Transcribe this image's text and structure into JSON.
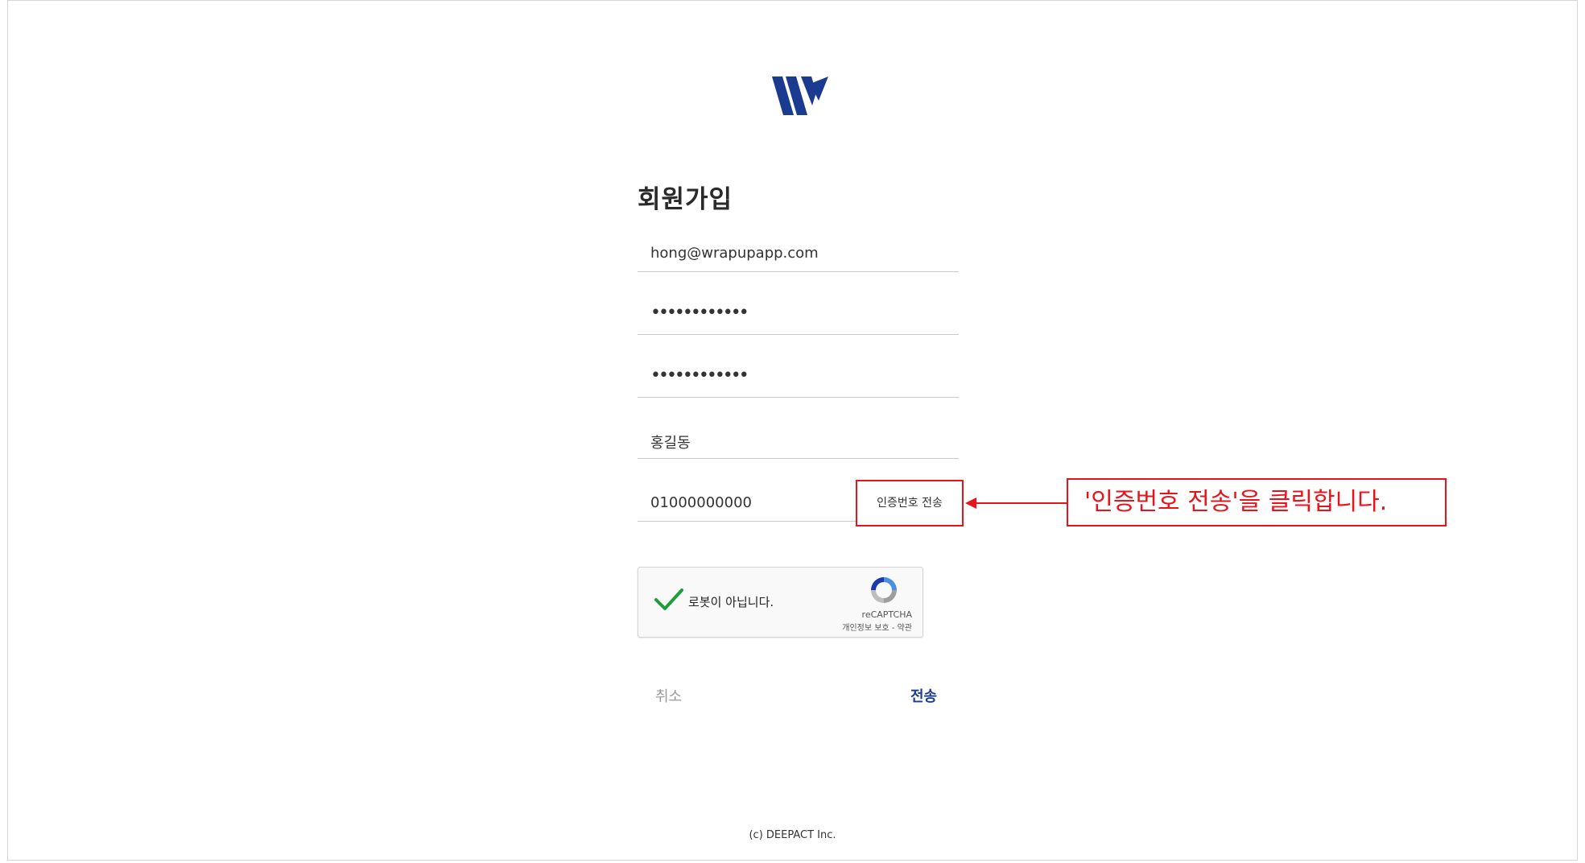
{
  "signup": {
    "title": "회원가입",
    "email_value": "hong@wrapupapp.com",
    "password_value": "••••••••••••",
    "password_confirm_value": "••••••••••••",
    "name_value": "홍길동",
    "phone_value": "01000000000",
    "send_code_label": "인증번호 전송",
    "cancel_label": "취소",
    "submit_label": "전송"
  },
  "recaptcha": {
    "label": "로봇이 아닙니다.",
    "brand": "reCAPTCHA",
    "links": "개인정보 보호 - 약관",
    "checked": true
  },
  "callout": {
    "text": "'인증번호 전송'을 클릭합니다.",
    "color": "#e8141c"
  },
  "footer": {
    "copyright": "(c) DEEPACT Inc."
  },
  "colors": {
    "brand": "#1a3b8f",
    "check_green": "#1e9e3a",
    "annotation_red": "#e8141c"
  },
  "icons": {
    "logo": "wrapup-w-logo",
    "check": "check-icon",
    "recaptcha": "recaptcha-icon"
  }
}
